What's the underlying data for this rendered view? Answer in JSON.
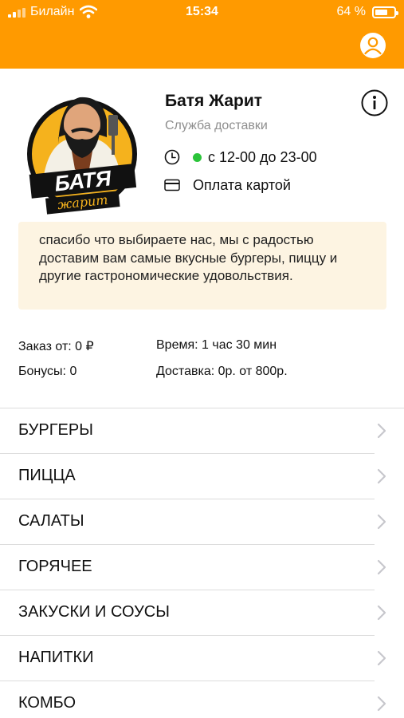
{
  "status_bar": {
    "carrier": "Билайн",
    "time": "15:34",
    "battery": "64 %",
    "battery_level": 0.64
  },
  "icons": {
    "profile": "user-circle-icon",
    "info": "info-icon",
    "clock": "clock-icon",
    "card": "credit-card-icon",
    "chevron": "chevron-right-icon"
  },
  "colors": {
    "header": "#ff9a00",
    "open_indicator": "#2bc43a",
    "notice_bg": "#fdf4e2"
  },
  "restaurant": {
    "logo_text": [
      "БАТЯ",
      "жарит"
    ],
    "name": "Батя Жарит",
    "subtitle": "Служба доставки",
    "hours": "с 12-00 до 23-00",
    "payment": "Оплата картой"
  },
  "notice": "спасибо что выбираете нас, мы с радостью доставим вам самые вкусные бургеры, пиццу и другие гастрономические удовольствия.",
  "stats": {
    "min_order": "Заказ от: 0 ₽",
    "time": "Время: 1 час 30 мин",
    "bonus": "Бонусы: 0",
    "delivery": "Доставка: 0р. от 800р."
  },
  "menu": [
    {
      "label": "БУРГЕРЫ"
    },
    {
      "label": "ПИЦЦА"
    },
    {
      "label": "САЛАТЫ"
    },
    {
      "label": "ГОРЯЧЕЕ"
    },
    {
      "label": "ЗАКУСКИ И СОУСЫ"
    },
    {
      "label": "НАПИТКИ"
    },
    {
      "label": "КОМБО"
    }
  ]
}
